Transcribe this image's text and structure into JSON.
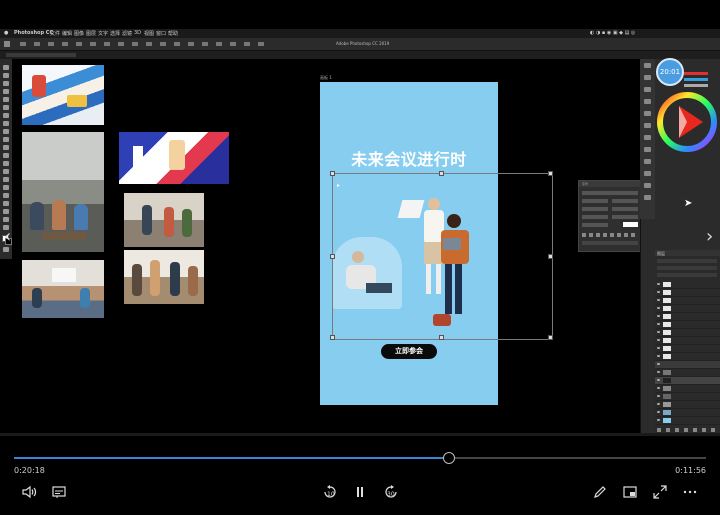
{
  "menubar": {
    "app_name": "Photoshop CC",
    "menus": [
      "文件",
      "编辑",
      "图像",
      "图层",
      "文字",
      "选择",
      "滤镜",
      "3D",
      "视图",
      "窗口",
      "帮助"
    ]
  },
  "window_title": "Adobe Photoshop CC 2019",
  "artboard": {
    "label": "画板 1",
    "headline": "未来会议进行时",
    "cta_label": "立即参会",
    "background": "#86cdf0"
  },
  "clock_badge": "20:01",
  "player": {
    "elapsed": "0:20:18",
    "remaining": "0:11:56",
    "progress_fraction": 0.627,
    "accent": "#3a86d6"
  },
  "layers_title": "图层",
  "char_panel_title": "字符"
}
